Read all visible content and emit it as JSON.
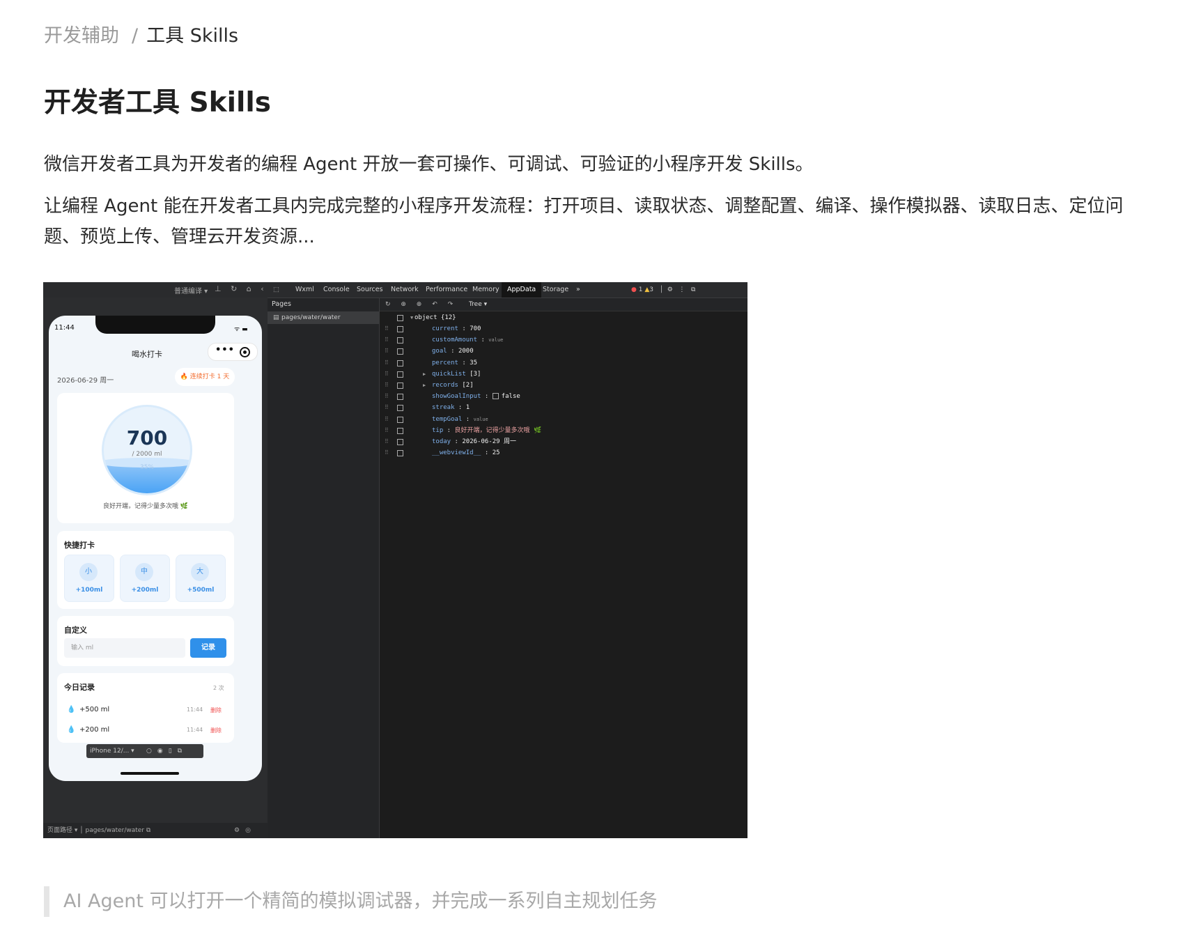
{
  "breadcrumb": {
    "parent": "开发辅助",
    "separator": "/",
    "current": "工具 Skills"
  },
  "page": {
    "title": "开发者工具 Skills",
    "para1": "微信开发者工具为开发者的编程 Agent 开放一套可操作、可调试、可验证的小程序开发 Skills。",
    "para2": "让编程 Agent 能在开发者工具内完成完整的小程序开发流程：打开项目、读取状态、调整配置、编译、操作模拟器、读取日志、定位问题、预览上传、管理云开发资源...",
    "quote": "AI Agent 可以打开一个精简的模拟调试器，并完成一系列自主规划任务"
  },
  "screenshot": {
    "simulator_toolbar": {
      "compile_mode": "普通编译 ▾",
      "icons": [
        "pin-icon",
        "refresh-icon",
        "clear-icon",
        "collapse-icon"
      ]
    },
    "phone": {
      "time": "11:44",
      "status_icons": "ᯤ ▬",
      "title": "喝水打卡",
      "date": "2026-06-29 周一",
      "streak": "🔥 连续打卡 1 天",
      "current": "700",
      "goal": "/ 2000 ml",
      "percent_label": "35%",
      "percent_fill": 0.35,
      "tip": "良好开端，记得少量多次哦 🌿",
      "quick": {
        "label": "快捷打卡",
        "buttons": [
          {
            "size": "小",
            "amount": "+100ml"
          },
          {
            "size": "中",
            "amount": "+200ml"
          },
          {
            "size": "大",
            "amount": "+500ml"
          }
        ]
      },
      "custom": {
        "label": "自定义",
        "placeholder": "输入 ml",
        "button": "记录"
      },
      "records": {
        "label": "今日记录",
        "count": "2 次",
        "rows": [
          {
            "amount": "+500 ml",
            "time": "11:44",
            "action": "删除"
          },
          {
            "amount": "+200 ml",
            "time": "11:44",
            "action": "删除"
          }
        ]
      }
    },
    "device_bar": {
      "device": "iPhone 12/... ▾"
    },
    "sim_footer": {
      "path_label": "页面路径 ▾",
      "path": "pages/water/water"
    },
    "devtools": {
      "tabs": [
        "Wxml",
        "Console",
        "Sources",
        "Network",
        "Performance",
        "Memory",
        "AppData",
        "Storage",
        "»"
      ],
      "active_tab": "AppData",
      "errors": "1",
      "warnings": "3",
      "pages_header": "Pages",
      "pages_item": "pages/water/water",
      "view_mode": "Tree ▾",
      "root": "object {12}",
      "rows": [
        {
          "key": "current",
          "value": "700",
          "type": "num"
        },
        {
          "key": "customAmount",
          "value": "value",
          "type": "small"
        },
        {
          "key": "goal",
          "value": "2000",
          "type": "num"
        },
        {
          "key": "percent",
          "value": "35",
          "type": "num"
        },
        {
          "key": "quickList",
          "value": "[3]",
          "type": "plain",
          "expandable": true
        },
        {
          "key": "records",
          "value": "[2]",
          "type": "plain",
          "expandable": true
        },
        {
          "key": "showGoalInput",
          "value": "false",
          "type": "bool"
        },
        {
          "key": "streak",
          "value": "1",
          "type": "num"
        },
        {
          "key": "tempGoal",
          "value": "value",
          "type": "small"
        },
        {
          "key": "tip",
          "value": "良好开端，记得少量多次哦 🌿",
          "type": "str"
        },
        {
          "key": "today",
          "value": "2026-06-29 周一",
          "type": "num"
        },
        {
          "key": "__webviewId__",
          "value": "25",
          "type": "num"
        }
      ]
    }
  }
}
